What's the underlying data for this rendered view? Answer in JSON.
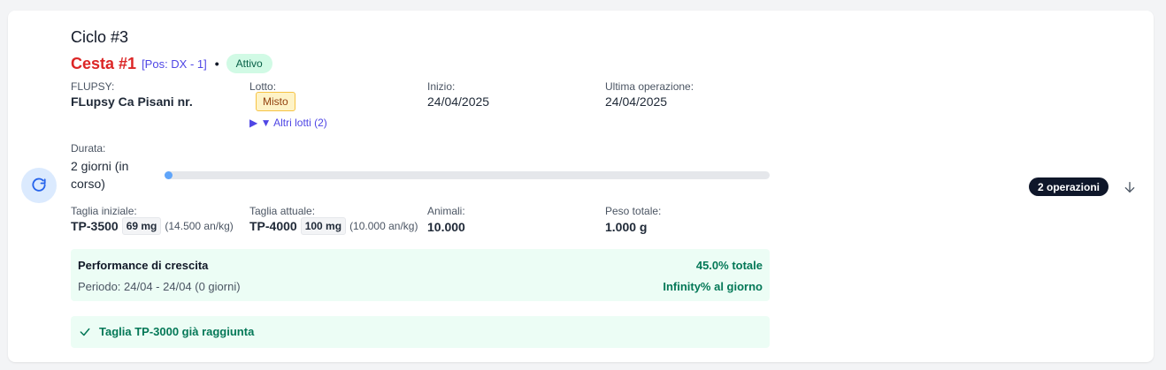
{
  "cycle": {
    "title": "Ciclo #3"
  },
  "basket": {
    "name": "Cesta #1",
    "position": "[Pos: DX - 1]",
    "separator": "•",
    "status": "Attivo"
  },
  "info": {
    "flupsy_label": "FLUPSY:",
    "flupsy_value": "FLupsy Ca Pisani nr.",
    "lot_label": "Lotto:",
    "lot_badge": "Misto",
    "other_lots": "▶ ▼ Altri lotti (2)",
    "start_label": "Inizio:",
    "start_value": "24/04/2025",
    "last_op_label": "Ultima operazione:",
    "last_op_value": "24/04/2025"
  },
  "duration": {
    "label": "Durata:",
    "value": "2 giorni (in corso)",
    "progress_fraction": 0.005
  },
  "sizes": {
    "initial_label": "Taglia iniziale:",
    "initial_size": "TP-3500",
    "initial_weight": "69 mg",
    "initial_per_kg": "(14.500 an/kg)",
    "current_label": "Taglia attuale:",
    "current_size": "TP-4000",
    "current_weight": "100 mg",
    "current_per_kg": "(10.000 an/kg)",
    "animals_label": "Animali:",
    "animals_value": "10.000",
    "weight_label": "Peso totale:",
    "weight_value": "1.000 g"
  },
  "performance": {
    "title": "Performance di crescita",
    "total": "45.0% totale",
    "period": "Periodo: 24/04 - 24/04 (0 giorni)",
    "daily": "Infinity% al giorno"
  },
  "goal": {
    "text": "Taglia TP-3000 già raggiunta"
  },
  "operations": {
    "label": "2 operazioni"
  },
  "colors": {
    "basket": "#dc2626",
    "accent": "#4f46e5",
    "success": "#047857",
    "progress": "#60a5fa"
  }
}
